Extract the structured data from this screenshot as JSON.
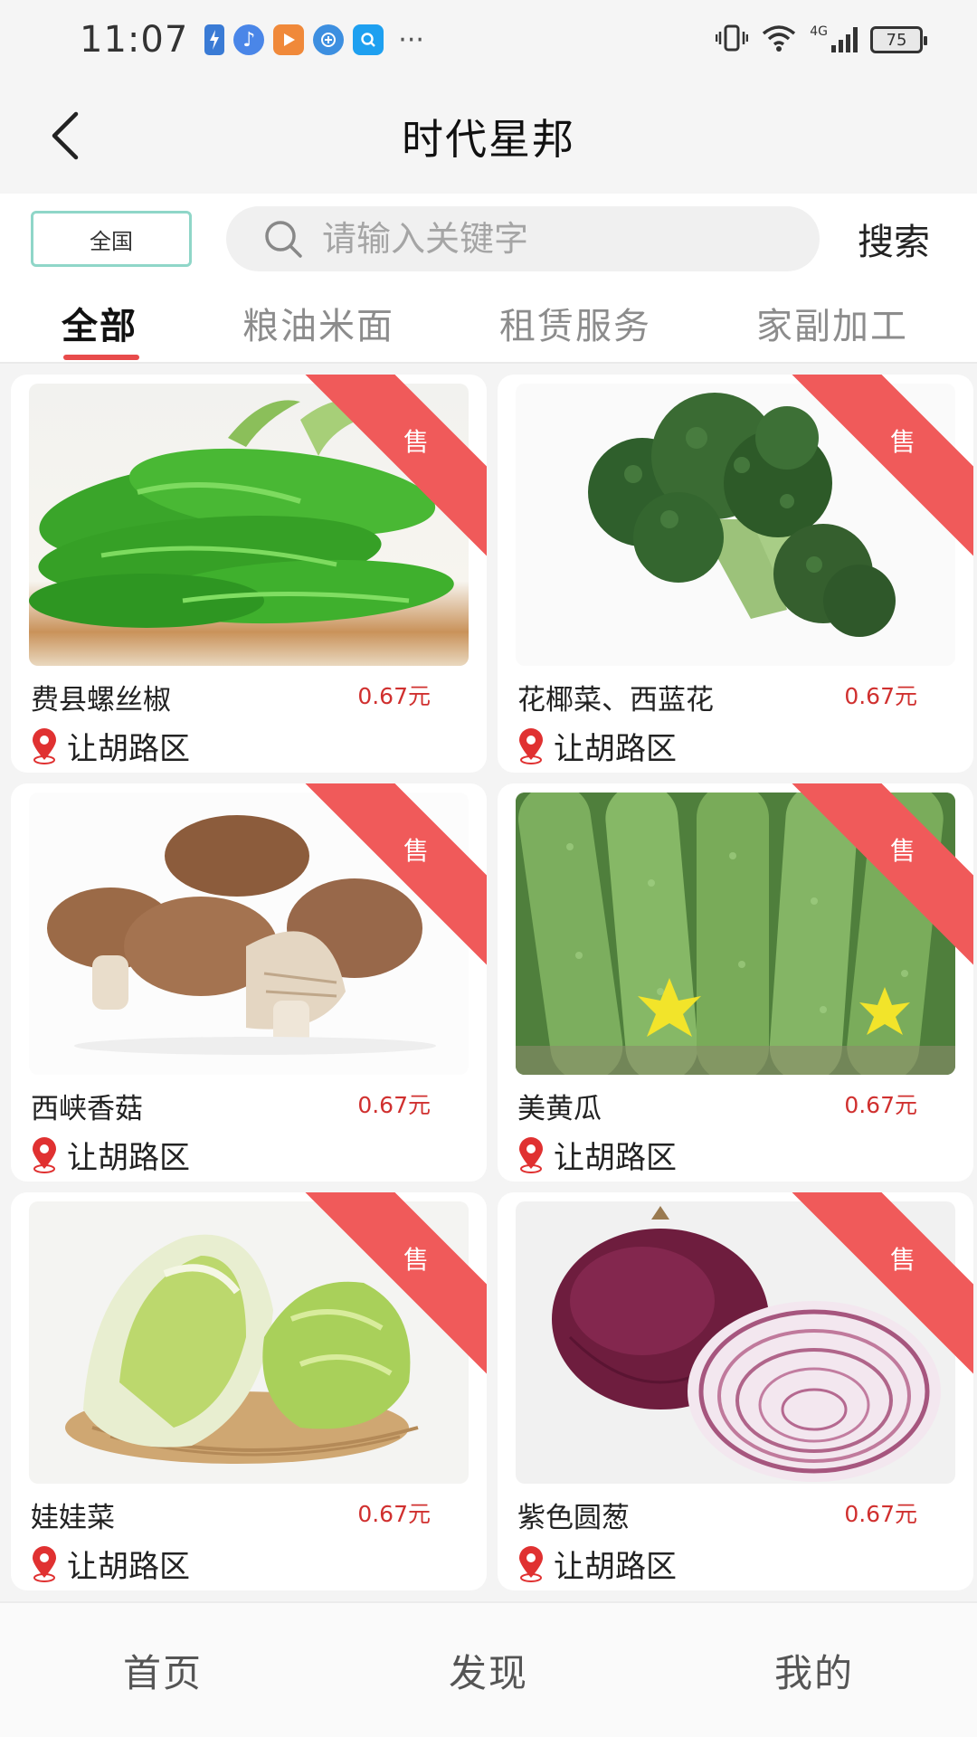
{
  "status_bar": {
    "time": "11:07",
    "network": "4G",
    "battery": "75",
    "more": "···"
  },
  "header": {
    "title": "时代星邦"
  },
  "search": {
    "region": "全国",
    "placeholder": "请输入关键字",
    "button": "搜索"
  },
  "tabs": [
    {
      "label": "全部",
      "active": true
    },
    {
      "label": "粮油米面",
      "active": false
    },
    {
      "label": "租赁服务",
      "active": false
    },
    {
      "label": "家副加工",
      "active": false
    }
  ],
  "products": [
    {
      "name": "费县螺丝椒",
      "price": "0.67元",
      "location": "让胡路区",
      "badge": "售",
      "image": "green-pepper"
    },
    {
      "name": "花椰菜、西蓝花",
      "price": "0.67元",
      "location": "让胡路区",
      "badge": "售",
      "image": "broccoli"
    },
    {
      "name": "西峡香菇",
      "price": "0.67元",
      "location": "让胡路区",
      "badge": "售",
      "image": "mushroom"
    },
    {
      "name": "美黄瓜",
      "price": "0.67元",
      "location": "让胡路区",
      "badge": "售",
      "image": "cucumber"
    },
    {
      "name": "娃娃菜",
      "price": "0.67元",
      "location": "让胡路区",
      "badge": "售",
      "image": "baby-cabbage"
    },
    {
      "name": "紫色圆葱",
      "price": "0.67元",
      "location": "让胡路区",
      "badge": "售",
      "image": "red-onion"
    }
  ],
  "bottom_nav": [
    {
      "label": "首页"
    },
    {
      "label": "发现"
    },
    {
      "label": "我的"
    }
  ],
  "colors": {
    "accent": "#e84b4b",
    "price": "#d0302f",
    "ribbon": "#f05a5a",
    "region_border": "#8fd6c8"
  }
}
